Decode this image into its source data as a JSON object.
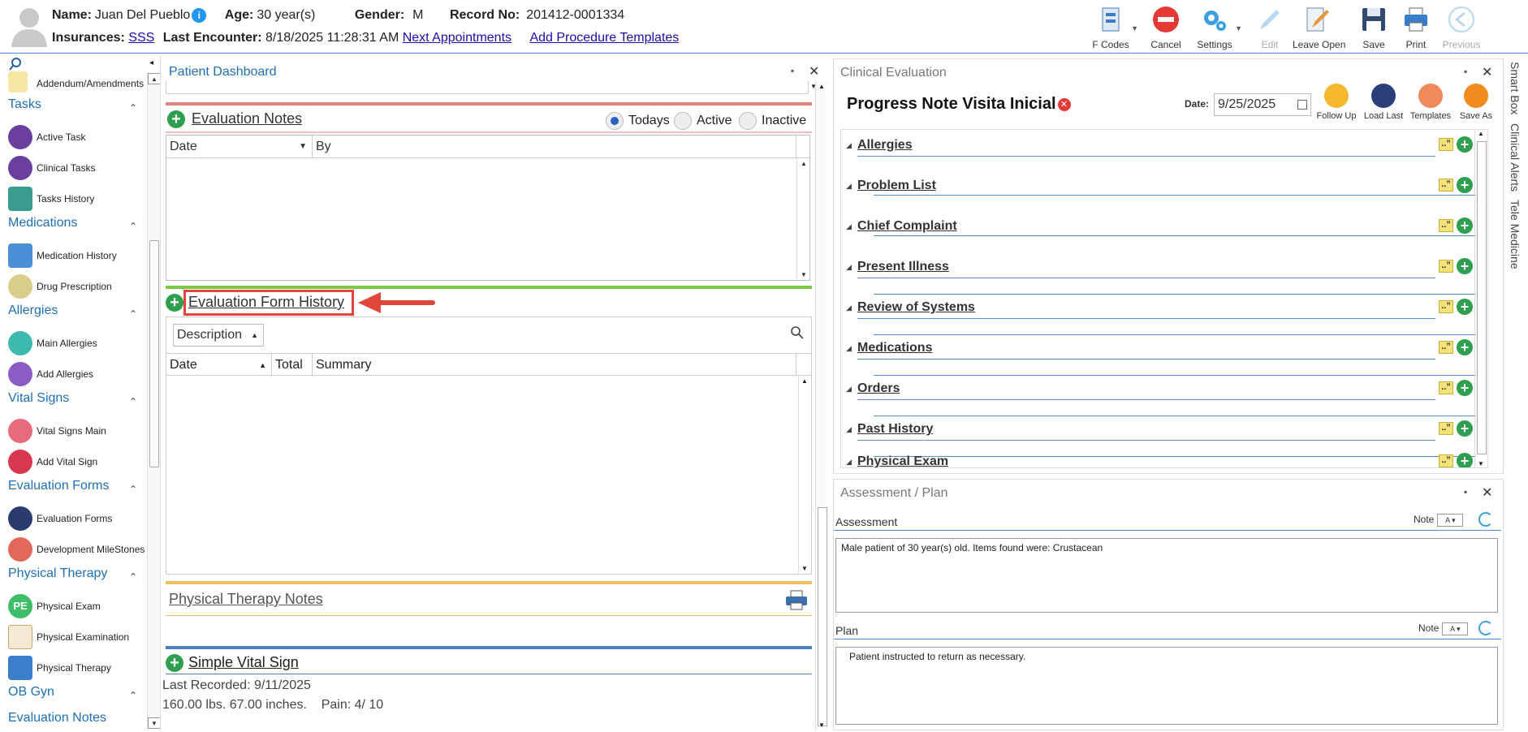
{
  "patient": {
    "name_label": "Name:",
    "name": "Juan Del Pueblo",
    "age_label": "Age:",
    "age": "30 year(s)",
    "gender_label": "Gender:",
    "gender": "M",
    "record_label": "Record No:",
    "record": "201412-0001334",
    "insurances_label": "Insurances:",
    "insurance": "SSS",
    "last_encounter_label": "Last Encounter:",
    "last_encounter": "8/18/2025 11:28:31 AM",
    "next_appointments": "Next Appointments",
    "add_procedure_templates": "Add Procedure Templates"
  },
  "toolbar": {
    "fcodes": "F Codes",
    "cancel": "Cancel",
    "settings": "Settings",
    "edit": "Edit",
    "leave_open": "Leave Open",
    "save": "Save",
    "print": "Print",
    "previous": "Previous"
  },
  "sidebar": {
    "addendum": "Addendum/Amendments",
    "tasks": "Tasks",
    "active_task": "Active Task",
    "clinical_tasks": "Clinical Tasks",
    "tasks_history": "Tasks History",
    "medications": "Medications",
    "medication_history": "Medication History",
    "drug_prescription": "Drug Prescription",
    "allergies": "Allergies",
    "main_allergies": "Main Allergies",
    "add_allergies": "Add Allergies",
    "vital_signs": "Vital Signs",
    "vital_signs_main": "Vital Signs Main",
    "add_vital_sign": "Add Vital Sign",
    "evaluation_forms": "Evaluation Forms",
    "evaluation_forms_item": "Evaluation Forms",
    "development_milestones": "Development MileStones",
    "physical_therapy": "Physical Therapy",
    "physical_exam": "Physical Exam",
    "physical_examination": "Physical Examination",
    "physical_therapy_item": "Physical Therapy",
    "ob_gyn": "OB Gyn",
    "evaluation_notes": "Evaluation Notes",
    "pe_badge": "PE"
  },
  "dashboard": {
    "title": "Patient Dashboard",
    "evaluation_notes": "Evaluation Notes",
    "filter_todays": "Todays",
    "filter_active": "Active",
    "filter_inactive": "Inactive",
    "col_date": "Date",
    "col_by": "By",
    "evaluation_form_history": "Evaluation Form History",
    "description": "Description",
    "hist_col_date": "Date",
    "hist_col_total": "Total",
    "hist_col_summary": "Summary",
    "physical_therapy_notes": "Physical Therapy Notes",
    "simple_vital_sign": "Simple Vital Sign",
    "last_recorded": "Last Recorded: 9/11/2025",
    "vital_values": "160.00 lbs. 67.00 inches.    Pain: 4/ 10"
  },
  "clinical": {
    "title": "Clinical Evaluation",
    "note_title": "Progress Note Visita Inicial",
    "date_label": "Date:",
    "date": "9/25/2025",
    "follow_up": "Follow Up",
    "load_last": "Load Last",
    "templates": "Templates",
    "save_as": "Save As",
    "sections": [
      "Allergies",
      "Problem List",
      "Chief Complaint",
      "Present Illness",
      "Review of Systems",
      "Medications",
      "Orders",
      "Past History",
      "Physical Exam"
    ]
  },
  "assessment_plan": {
    "title": "Assessment / Plan",
    "assessment_label": "Assessment",
    "note_label": "Note",
    "assessment_text": "Male patient of 30 year(s) old. Items found were:  Crustacean",
    "plan_label": "Plan",
    "plan_note_label": "Note",
    "plan_text": "Patient instructed to return as necessary."
  },
  "side_tabs": {
    "smart_box": "Smart Box",
    "clinical_alerts": "Clinical Alerts",
    "tele_medicine": "Tele Medicine"
  },
  "colors": {
    "accent": "#1f6fb8",
    "highlight": "#e0463a",
    "add_green": "#2e9e4f"
  }
}
